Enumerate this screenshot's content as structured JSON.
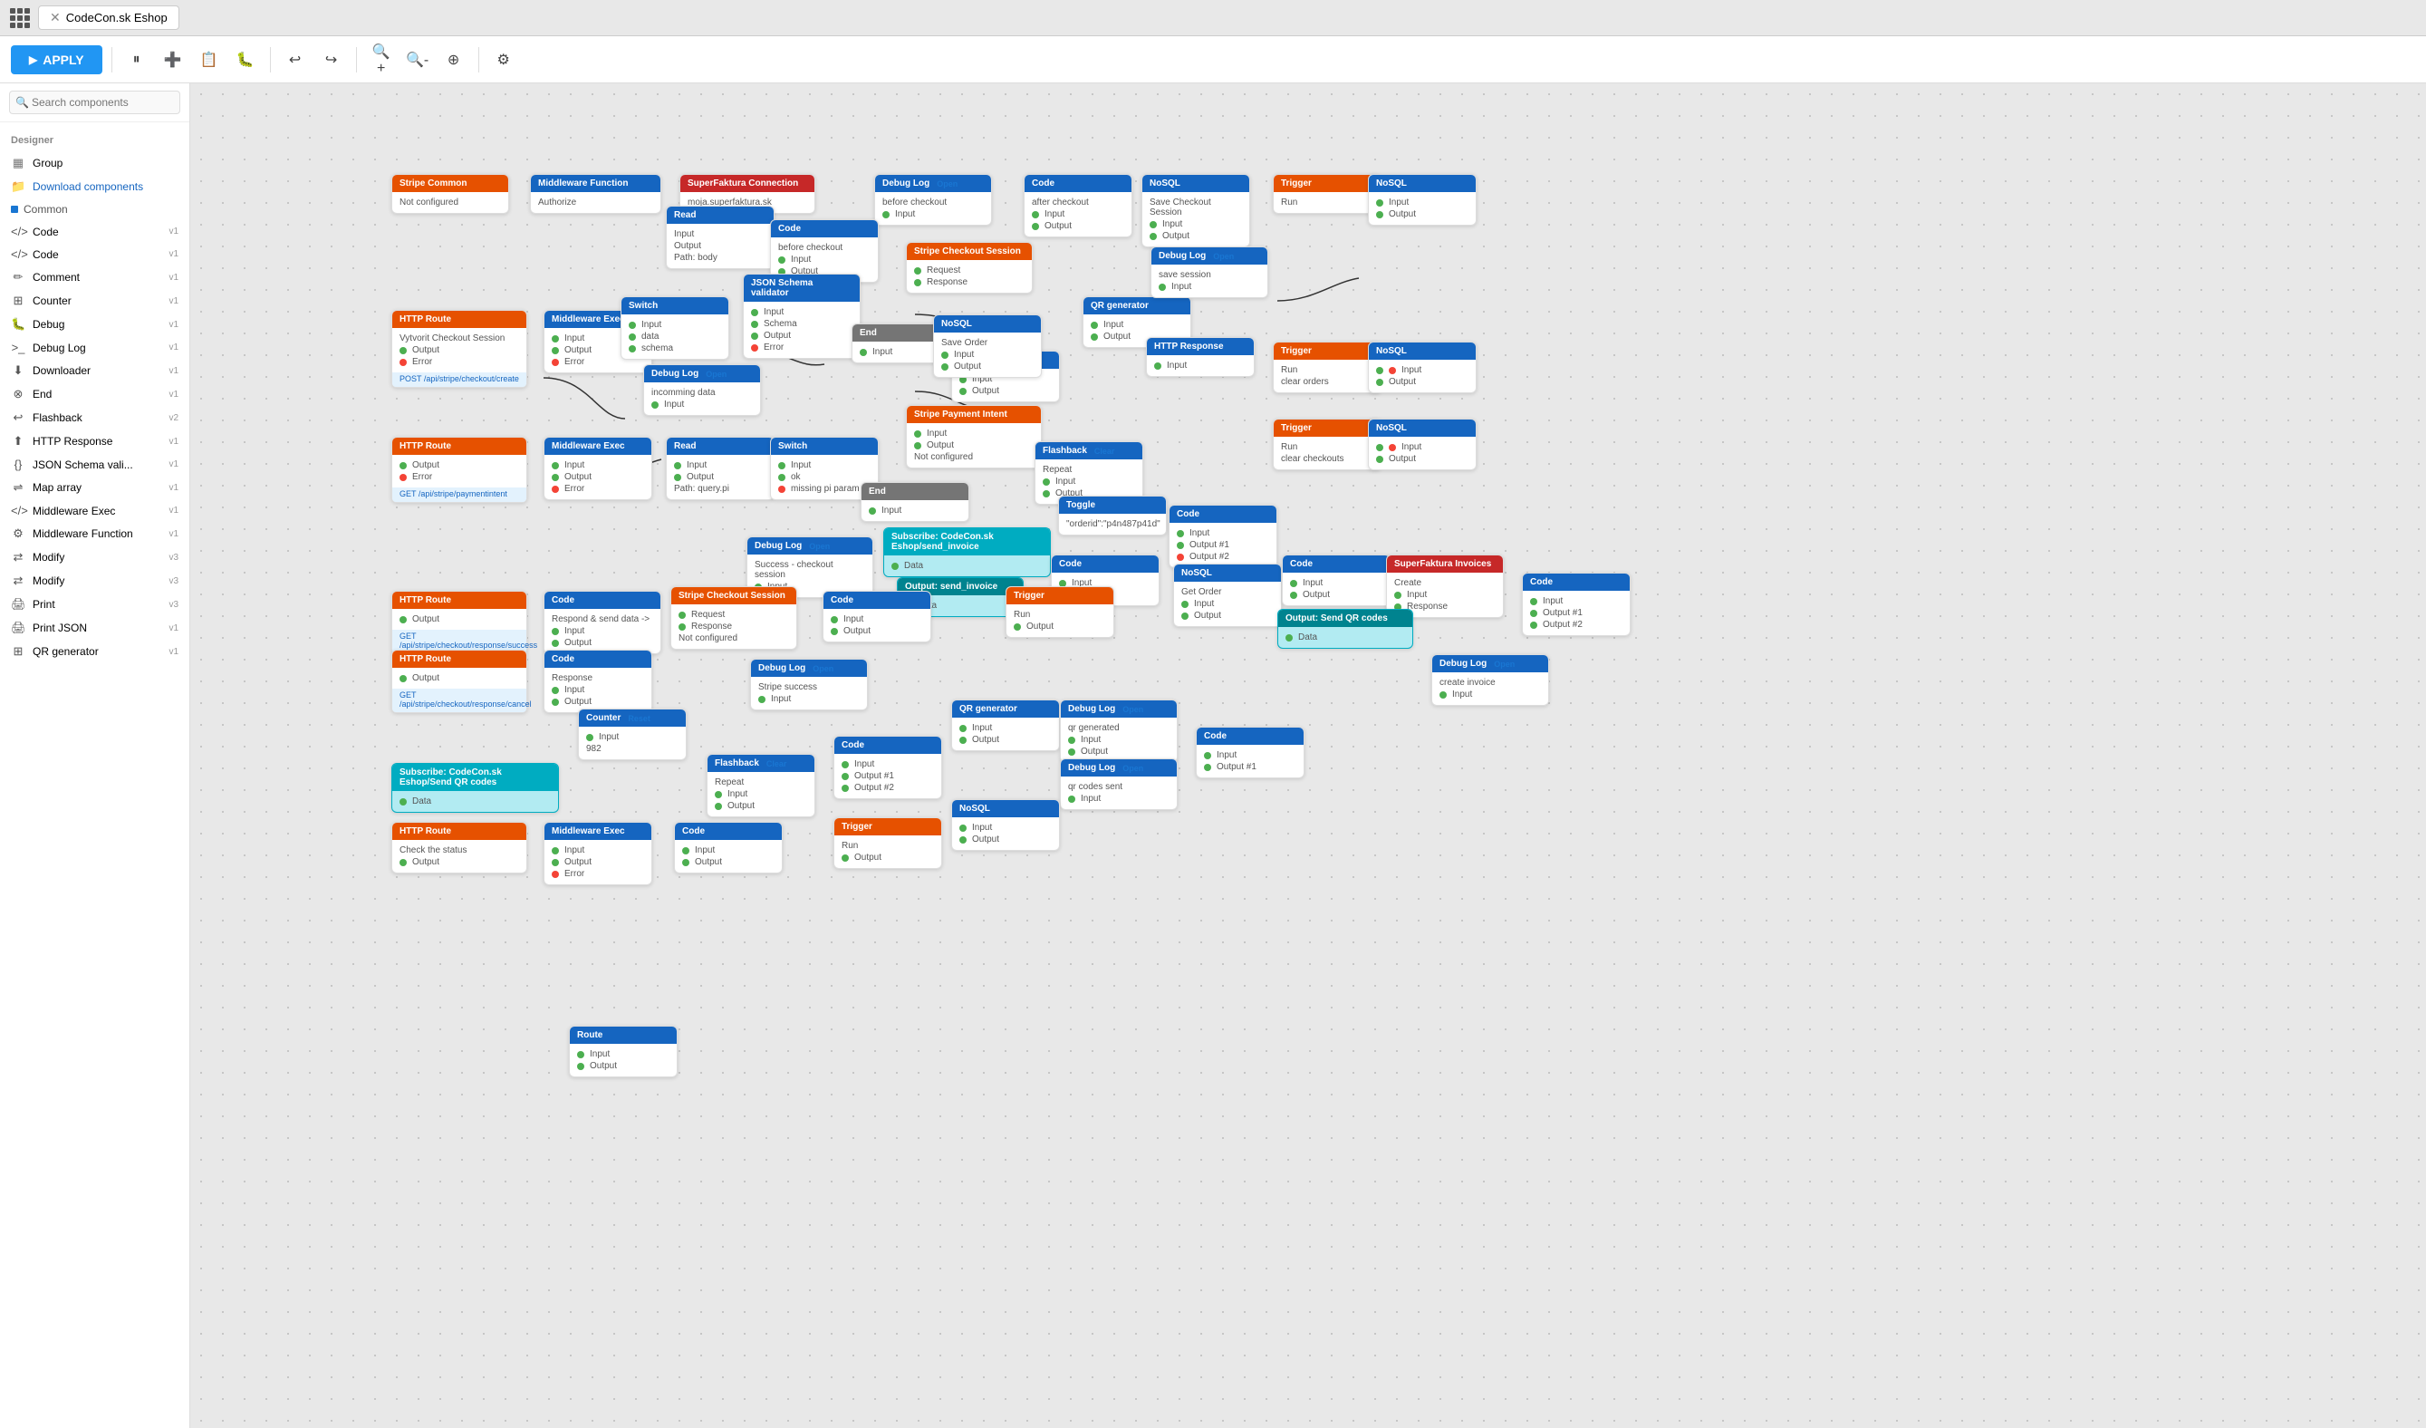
{
  "topbar": {
    "tab_label": "CodeCon.sk Eshop"
  },
  "toolbar": {
    "apply_label": "APPLY"
  },
  "sidebar": {
    "search_placeholder": "Search components",
    "designer_label": "Designer",
    "group_label": "Group",
    "download_label": "Download components",
    "common_label": "Common",
    "items": [
      {
        "label": "Code",
        "badge": "v1",
        "icon": "</>"
      },
      {
        "label": "Code",
        "badge": "v1",
        "icon": "</>"
      },
      {
        "label": "Comment",
        "badge": "v1",
        "icon": "💬"
      },
      {
        "label": "Counter",
        "badge": "v1",
        "icon": "🔢"
      },
      {
        "label": "Debug",
        "badge": "v1",
        "icon": "🐛"
      },
      {
        "label": "Debug Log",
        "badge": "v1",
        "icon": ">_"
      },
      {
        "label": "Downloader",
        "badge": "v1",
        "icon": "⬇"
      },
      {
        "label": "End",
        "badge": "v1",
        "icon": "⊗"
      },
      {
        "label": "Flashback",
        "badge": "v2",
        "icon": "↩"
      },
      {
        "label": "HTTP Response",
        "badge": "v1",
        "icon": "⬆"
      },
      {
        "label": "JSON Schema vali...",
        "badge": "v1",
        "icon": "{}"
      },
      {
        "label": "Map array",
        "badge": "v1",
        "icon": "⇌"
      },
      {
        "label": "Middleware Exec",
        "badge": "v1",
        "icon": "</>"
      },
      {
        "label": "Middleware Function",
        "badge": "v1",
        "icon": "⚙"
      },
      {
        "label": "Modify",
        "badge": "v3",
        "icon": "⇄"
      },
      {
        "label": "Modify",
        "badge": "v3",
        "icon": "⇄"
      },
      {
        "label": "Print",
        "badge": "v3",
        "icon": "🖨"
      },
      {
        "label": "Print JSON",
        "badge": "v1",
        "icon": "🖨"
      },
      {
        "label": "QR generator",
        "badge": "v1",
        "icon": "⊞"
      }
    ]
  },
  "canvas": {
    "nodes": []
  }
}
